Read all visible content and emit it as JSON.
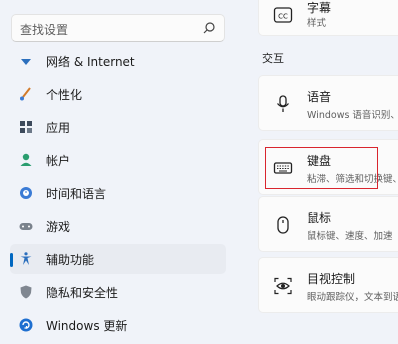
{
  "search": {
    "placeholder": "查找设置"
  },
  "nav": [
    {
      "label": "网络 & Internet",
      "icon": "network-icon"
    },
    {
      "label": "个性化",
      "icon": "brush-icon"
    },
    {
      "label": "应用",
      "icon": "apps-icon"
    },
    {
      "label": "帐户",
      "icon": "account-icon"
    },
    {
      "label": "时间和语言",
      "icon": "time-language-icon"
    },
    {
      "label": "游戏",
      "icon": "gaming-icon"
    },
    {
      "label": "辅助功能",
      "icon": "accessibility-icon",
      "active": true
    },
    {
      "label": "隐私和安全性",
      "icon": "shield-icon"
    },
    {
      "label": "Windows 更新",
      "icon": "update-icon"
    }
  ],
  "content": {
    "top_card": {
      "title": "字幕",
      "subtitle": "样式"
    },
    "section": "交互",
    "cards": [
      {
        "title": "语音",
        "subtitle": "Windows 语音识别、",
        "icon": "microphone-icon"
      },
      {
        "title": "键盘",
        "subtitle": "粘滞、筛选和切换键、",
        "icon": "keyboard-icon"
      },
      {
        "title": "鼠标",
        "subtitle": "鼠标键、速度、加速",
        "icon": "mouse-icon"
      },
      {
        "title": "目视控制",
        "subtitle": "眼动跟踪仪，文本到语",
        "icon": "eye-control-icon"
      }
    ]
  },
  "colors": {
    "accent": "#0067c0",
    "highlight": "#d9252e"
  }
}
